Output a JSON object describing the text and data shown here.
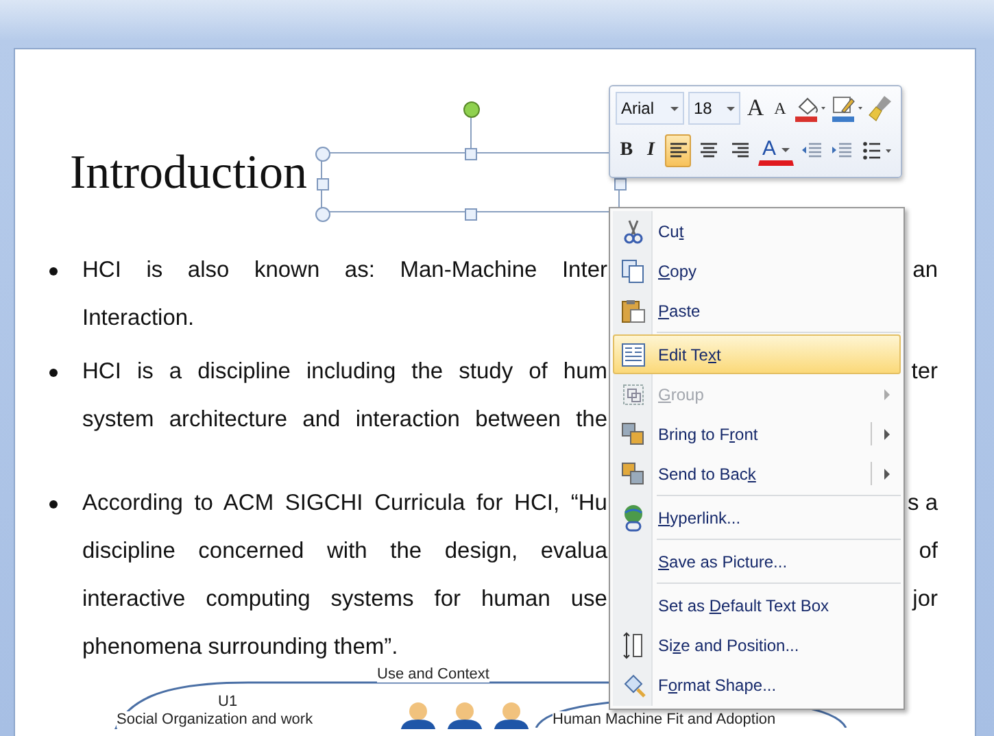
{
  "slide": {
    "title": "Introduction",
    "bullets": [
      {
        "lines": [
          {
            "left": "HCI is also known as: Man-Machine Inter",
            "right": "an",
            "full": true
          },
          {
            "left": "Interaction.",
            "full": false
          }
        ]
      },
      {
        "lines": [
          {
            "left": "HCI is a discipline including the study of hum",
            "right": "ter",
            "full": true
          },
          {
            "left": "system architecture and interaction between the",
            "full": true
          }
        ]
      },
      {
        "lines": [
          {
            "left": "According to ACM SIGCHI Curricula for HCI, “Hu",
            "right": "s a",
            "full": true
          },
          {
            "left": "discipline concerned with the design, evalua",
            "right": "of",
            "full": true
          },
          {
            "left": "interactive computing systems for human use",
            "right": "jor",
            "full": true
          },
          {
            "left": "phenomena surrounding them”.",
            "full": false
          }
        ]
      }
    ],
    "diagram": {
      "context_label": "Use and Context",
      "unit_label": "U1",
      "left_label": "Social Organization and work",
      "right_label": "Human Machine Fit and Adoption"
    }
  },
  "mini_toolbar": {
    "font": "Arial",
    "size": "18",
    "row_1": [
      {
        "kind": "grow-font",
        "label": "A"
      },
      {
        "kind": "shrink-font",
        "label": "A"
      },
      {
        "kind": "fill-color"
      },
      {
        "kind": "line-color"
      },
      {
        "kind": "format-painter"
      }
    ],
    "row_2": [
      {
        "kind": "bold",
        "label": "B",
        "selected": false
      },
      {
        "kind": "italic",
        "label": "I",
        "selected": false
      },
      {
        "kind": "align-left",
        "selected": true
      },
      {
        "kind": "align-center",
        "selected": false
      },
      {
        "kind": "align-right",
        "selected": false
      },
      {
        "kind": "font-color",
        "label": "A",
        "selected": false
      },
      {
        "kind": "decrease-indent",
        "selected": false
      },
      {
        "kind": "increase-indent",
        "selected": false
      },
      {
        "kind": "bullets",
        "selected": false
      }
    ]
  },
  "context_menu": [
    {
      "kind": "cut",
      "pre": "Cu",
      "key": "t",
      "selected": false,
      "disabled": false,
      "separator_before": false
    },
    {
      "kind": "copy",
      "key": "C",
      "post": "opy",
      "selected": false,
      "disabled": false,
      "separator_before": false
    },
    {
      "kind": "paste",
      "key": "P",
      "post": "aste",
      "selected": false,
      "disabled": false,
      "separator_before": false
    },
    {
      "kind": "edit-text",
      "pre": "Edit Te",
      "key": "x",
      "post": "t",
      "selected": true,
      "disabled": false,
      "separator_before": true
    },
    {
      "kind": "group",
      "key": "G",
      "post": "roup",
      "selected": false,
      "disabled": true,
      "separator_before": false,
      "submenu": true,
      "split": false
    },
    {
      "kind": "bring-front",
      "pre": "Bring to F",
      "key": "r",
      "post": "ont",
      "selected": false,
      "disabled": false,
      "separator_before": false,
      "submenu": true,
      "split": true
    },
    {
      "kind": "send-back",
      "pre": "Send to Bac",
      "key": "k",
      "selected": false,
      "disabled": false,
      "separator_before": false,
      "submenu": true,
      "split": true
    },
    {
      "kind": "hyperlink",
      "key": "H",
      "post": "yperlink...",
      "selected": false,
      "disabled": false,
      "separator_before": true
    },
    {
      "kind": "save-picture",
      "key": "S",
      "post": "ave as Picture...",
      "selected": false,
      "disabled": false,
      "separator_before": true
    },
    {
      "kind": "default-textbox",
      "pre": "Set as ",
      "key": "D",
      "post": "efault Text Box",
      "selected": false,
      "disabled": false,
      "separator_before": true
    },
    {
      "kind": "size-position",
      "pre": "Si",
      "key": "z",
      "post": "e and Position...",
      "selected": false,
      "disabled": false,
      "separator_before": false
    },
    {
      "kind": "format-shape",
      "pre": "F",
      "key": "o",
      "post": "rmat Shape...",
      "selected": false,
      "disabled": false,
      "separator_before": false
    }
  ]
}
